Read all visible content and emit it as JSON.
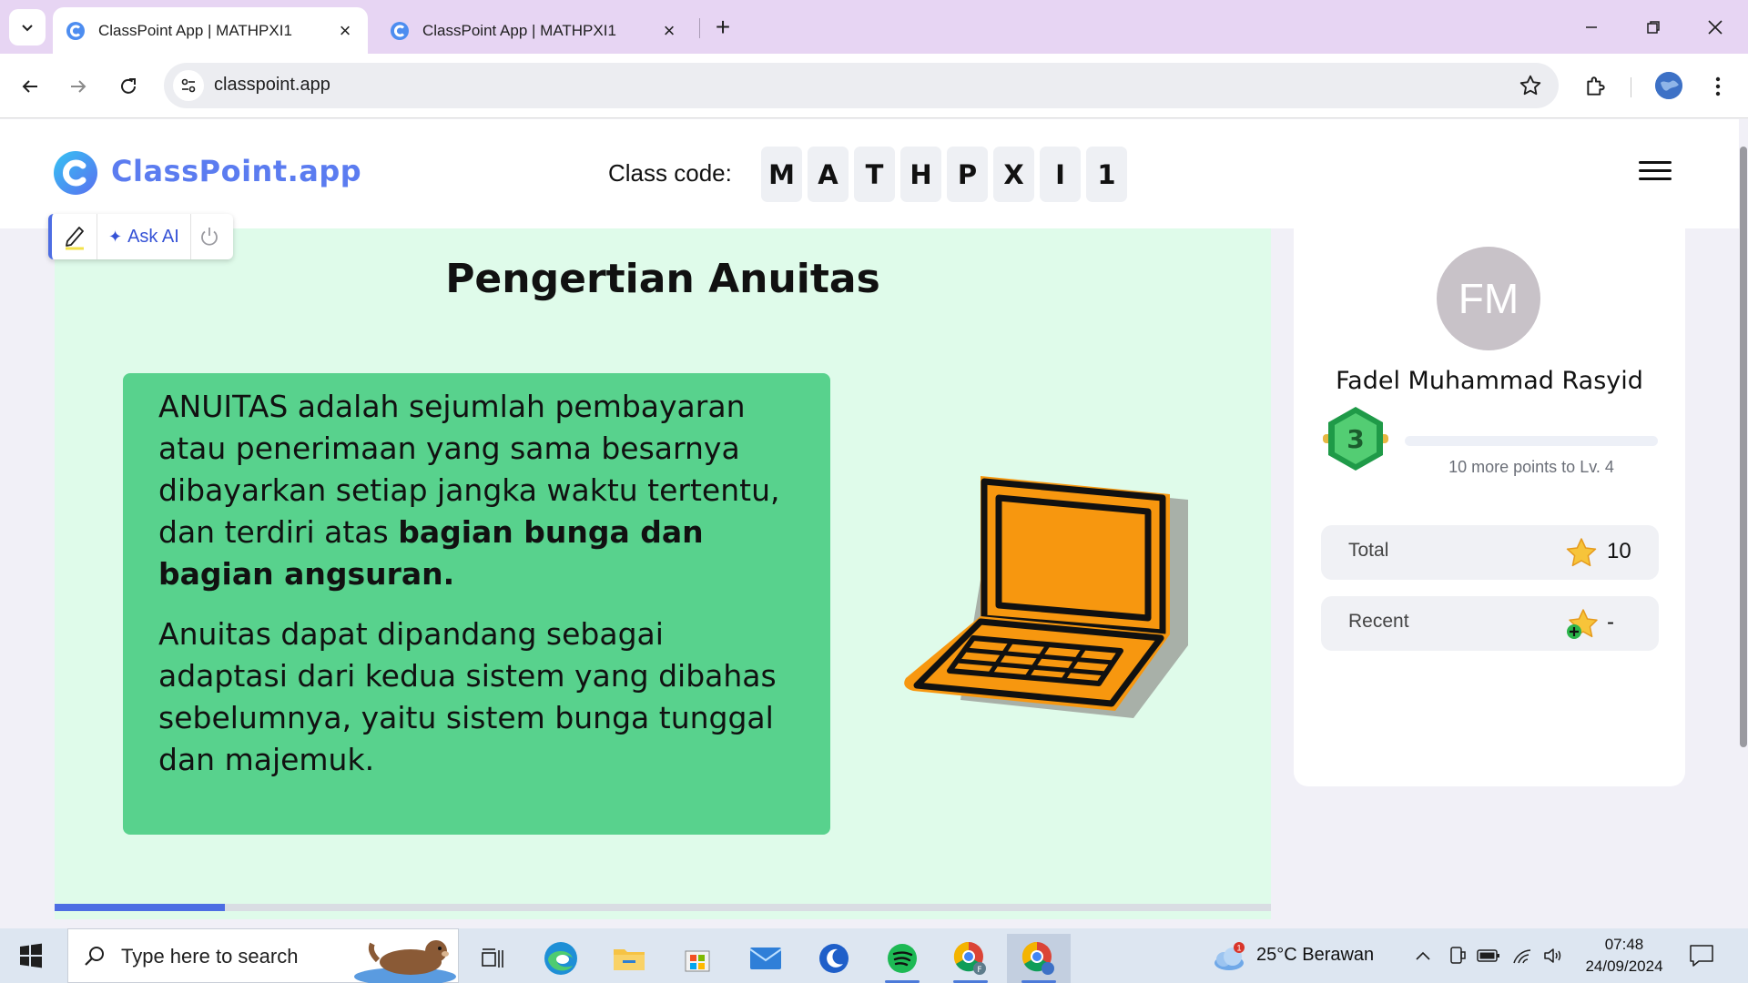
{
  "browser": {
    "tabs": [
      {
        "title": "ClassPoint App | MATHPXI1",
        "active": true
      },
      {
        "title": "ClassPoint App | MATHPXI1",
        "active": false
      }
    ],
    "address": "classpoint.app",
    "accent_color": "#e7d5f3"
  },
  "app": {
    "logo_text": "ClassPoint.app",
    "class_code_label": "Class code:",
    "class_code_chars": [
      "M",
      "A",
      "T",
      "H",
      "P",
      "X",
      "I",
      "1"
    ],
    "brand_color": "#5b7cf0"
  },
  "tools": {
    "ask_ai_label": "Ask AI",
    "icons": [
      "pen-icon",
      "sparkle-icon",
      "power-icon"
    ]
  },
  "slide": {
    "title": "Pengertian Anuitas",
    "paragraph1_normal": "ANUITAS adalah sejumlah pembayaran atau penerimaan yang sama besarnya dibayarkan setiap jangka waktu tertentu, dan terdiri atas ",
    "paragraph1_bold": "bagian bunga dan bagian angsuran.",
    "paragraph2": "Anuitas dapat dipandang sebagai adaptasi dari kedua sistem yang dibahas sebelumnya, yaitu sistem bunga tunggal dan majemuk.",
    "illustration": "laptop-icon",
    "progress_fraction": 0.14,
    "background_color": "#dffbea",
    "card_color": "#58d28d"
  },
  "student": {
    "initials": "FM",
    "name": "Fadel Muhammad Rasyid",
    "level": "3",
    "level_progress_fraction": 0.0,
    "level_hint": "10 more points to Lv. 4",
    "stats": [
      {
        "label": "Total",
        "value": "10"
      },
      {
        "label": "Recent",
        "value": "-"
      }
    ]
  },
  "taskbar": {
    "search_placeholder": "Type here to search",
    "apps": [
      "task-view-icon",
      "edge-icon",
      "file-explorer-icon",
      "store-icon",
      "mail-icon",
      "app-moon-icon",
      "spotify-icon",
      "chrome-profile-icon",
      "chrome-icon"
    ],
    "weather_badge": "1",
    "weather": "25°C  Berawan",
    "time": "07:48",
    "date": "24/09/2024"
  }
}
